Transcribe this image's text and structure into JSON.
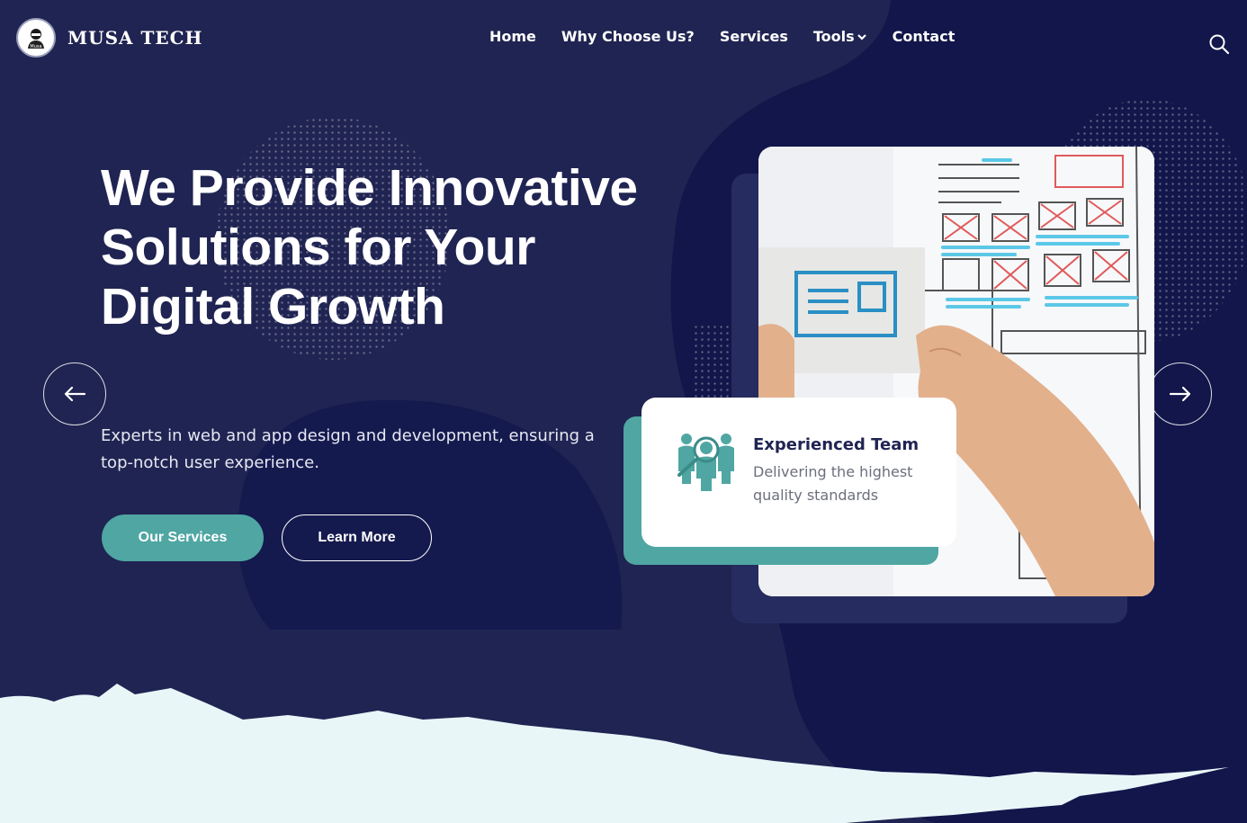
{
  "brand": {
    "name": "MUSA TECH",
    "logo_icon": "mascot-logo-icon",
    "logo_caption": "Musa"
  },
  "nav": {
    "items": [
      {
        "label": "Home"
      },
      {
        "label": "Why Choose Us?"
      },
      {
        "label": "Services"
      },
      {
        "label": "Tools",
        "icon": "chevron-down-icon"
      },
      {
        "label": "Contact"
      }
    ],
    "search_icon": "search-icon"
  },
  "hero": {
    "title": "We Provide Innovative Solutions for Your Digital Growth",
    "subtitle": "Experts in web and app design and development, ensuring a top-notch user experience.",
    "primary_button": "Our Services",
    "secondary_button": "Learn More",
    "prev_icon": "arrow-left-icon",
    "next_icon": "arrow-right-icon"
  },
  "feature_card": {
    "icon": "team-search-icon",
    "title": "Experienced Team",
    "text": "Delivering the highest quality standards"
  },
  "colors": {
    "background": "#202452",
    "background_dark": "#12164a",
    "accent": "#4fa6a3",
    "wave": "#e8f6f8"
  }
}
